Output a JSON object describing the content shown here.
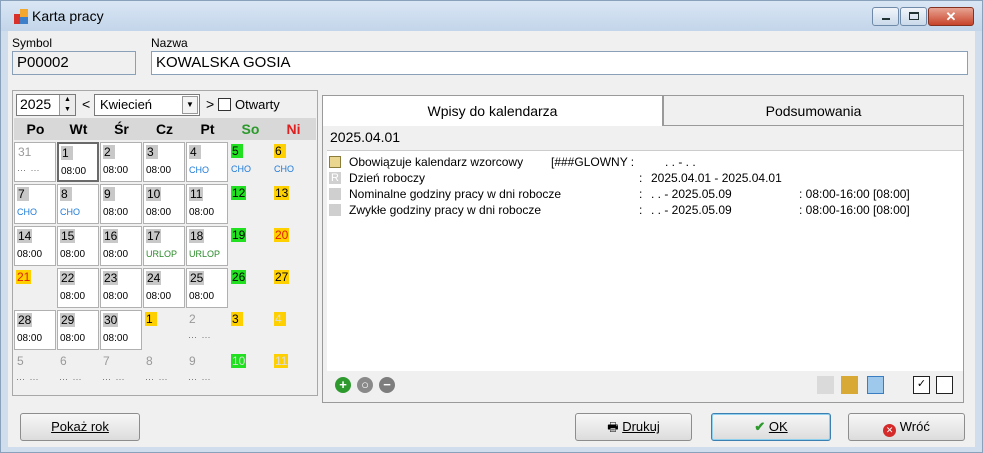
{
  "window": {
    "title": "Karta pracy"
  },
  "header": {
    "symbol_label": "Symbol",
    "symbol_value": "P00002",
    "nazwa_label": "Nazwa",
    "nazwa_value": "KOWALSKA GOSIA"
  },
  "calendar": {
    "year": "2025",
    "prev": "<",
    "month": "Kwiecień",
    "next": ">",
    "open_label": "Otwarty",
    "weekdays": [
      "Po",
      "Wt",
      "Śr",
      "Cz",
      "Pt",
      "So",
      "Ni"
    ],
    "weekday_colors": [
      "#000000",
      "#000000",
      "#000000",
      "#000000",
      "#000000",
      "#2a9a2a",
      "#e02020"
    ],
    "days": [
      {
        "n": "31",
        "sub": "⋯ ⋯",
        "style": "dim",
        "cell": "work"
      },
      {
        "n": "1",
        "sub": "08:00",
        "style": "gray",
        "cell": "cur"
      },
      {
        "n": "2",
        "sub": "08:00",
        "style": "gray",
        "cell": "work"
      },
      {
        "n": "3",
        "sub": "08:00",
        "style": "gray",
        "cell": "work"
      },
      {
        "n": "4",
        "sub": "CHO",
        "style": "gray",
        "cell": "work",
        "subStyle": "blue"
      },
      {
        "n": "5",
        "sub": "CHO",
        "style": "green",
        "cell": "none",
        "subStyle": "blue"
      },
      {
        "n": "6",
        "sub": "CHO",
        "style": "yellow",
        "cell": "none",
        "subStyle": "blue"
      },
      {
        "n": "7",
        "sub": "CHO",
        "style": "gray",
        "cell": "work",
        "subStyle": "blue"
      },
      {
        "n": "8",
        "sub": "CHO",
        "style": "gray",
        "cell": "work",
        "subStyle": "blue"
      },
      {
        "n": "9",
        "sub": "08:00",
        "style": "gray",
        "cell": "work"
      },
      {
        "n": "10",
        "sub": "08:00",
        "style": "gray",
        "cell": "work"
      },
      {
        "n": "11",
        "sub": "08:00",
        "style": "gray",
        "cell": "work"
      },
      {
        "n": "12",
        "sub": "",
        "style": "green",
        "cell": "none"
      },
      {
        "n": "13",
        "sub": "",
        "style": "yellow",
        "cell": "none"
      },
      {
        "n": "14",
        "sub": "08:00",
        "style": "gray",
        "cell": "work"
      },
      {
        "n": "15",
        "sub": "08:00",
        "style": "gray",
        "cell": "work"
      },
      {
        "n": "16",
        "sub": "08:00",
        "style": "gray",
        "cell": "work"
      },
      {
        "n": "17",
        "sub": "URLOP",
        "style": "gray",
        "cell": "work",
        "subStyle": "green"
      },
      {
        "n": "18",
        "sub": "URLOP",
        "style": "gray",
        "cell": "work",
        "subStyle": "green"
      },
      {
        "n": "19",
        "sub": "",
        "style": "green",
        "cell": "none"
      },
      {
        "n": "20",
        "sub": "",
        "style": "yellow-red",
        "cell": "none"
      },
      {
        "n": "21",
        "sub": "",
        "style": "yellow-red",
        "cell": "none"
      },
      {
        "n": "22",
        "sub": "08:00",
        "style": "gray",
        "cell": "work"
      },
      {
        "n": "23",
        "sub": "08:00",
        "style": "gray",
        "cell": "work"
      },
      {
        "n": "24",
        "sub": "08:00",
        "style": "gray",
        "cell": "work"
      },
      {
        "n": "25",
        "sub": "08:00",
        "style": "gray",
        "cell": "work"
      },
      {
        "n": "26",
        "sub": "",
        "style": "green",
        "cell": "none"
      },
      {
        "n": "27",
        "sub": "",
        "style": "yellow",
        "cell": "none"
      },
      {
        "n": "28",
        "sub": "08:00",
        "style": "gray",
        "cell": "work"
      },
      {
        "n": "29",
        "sub": "08:00",
        "style": "gray",
        "cell": "work"
      },
      {
        "n": "30",
        "sub": "08:00",
        "style": "gray",
        "cell": "work"
      },
      {
        "n": "1",
        "sub": "",
        "style": "yellow",
        "cell": "none"
      },
      {
        "n": "2",
        "sub": "⋯ ⋯",
        "style": "dim",
        "cell": "none"
      },
      {
        "n": "3",
        "sub": "",
        "style": "yellow",
        "cell": "none"
      },
      {
        "n": "4",
        "sub": "",
        "style": "yellow-dim",
        "cell": "none"
      },
      {
        "n": "5",
        "sub": "⋯ ⋯",
        "style": "dim",
        "cell": "none"
      },
      {
        "n": "6",
        "sub": "⋯ ⋯",
        "style": "dim",
        "cell": "none"
      },
      {
        "n": "7",
        "sub": "⋯ ⋯",
        "style": "dim",
        "cell": "none"
      },
      {
        "n": "8",
        "sub": "⋯ ⋯",
        "style": "dim",
        "cell": "none"
      },
      {
        "n": "9",
        "sub": "⋯ ⋯",
        "style": "dim",
        "cell": "none"
      },
      {
        "n": "10",
        "sub": "",
        "style": "green-dim",
        "cell": "none"
      },
      {
        "n": "11",
        "sub": "",
        "style": "yellow-dim",
        "cell": "none"
      }
    ]
  },
  "tabs": [
    {
      "label": "Wpisy do kalendarza",
      "active": true
    },
    {
      "label": "Podsumowania",
      "active": false
    }
  ],
  "entries_panel": {
    "date": "2025.04.01",
    "entries": [
      {
        "icon": "calendar-template-icon",
        "name": "Obowiązuje kalendarz wzorcowy",
        "col1": "[###GLOWNY :",
        "col2": ".   .   -   .   .",
        "col3": ""
      },
      {
        "icon": "r-icon",
        "icon_text": "R",
        "name": "Dzień roboczy",
        "col1": ":",
        "col2": "2025.04.01 - 2025.04.01",
        "col3": ""
      },
      {
        "icon": "gray-square-icon",
        "name": "Nominalne godziny pracy w dni robocze",
        "col1": ":",
        "col2": ".   .   - 2025.05.09",
        "col3": ":  08:00-16:00  [08:00]"
      },
      {
        "icon": "gray-square-icon",
        "name": "Zwykłe godziny pracy w dni robocze",
        "col1": ":",
        "col2": ".   .   - 2025.05.09",
        "col3": ":  08:00-16:00  [08:00]"
      }
    ]
  },
  "buttons": {
    "show_year": "Pokaż rok",
    "print": "Drukuj",
    "ok": "OK",
    "back": "Wróć"
  }
}
